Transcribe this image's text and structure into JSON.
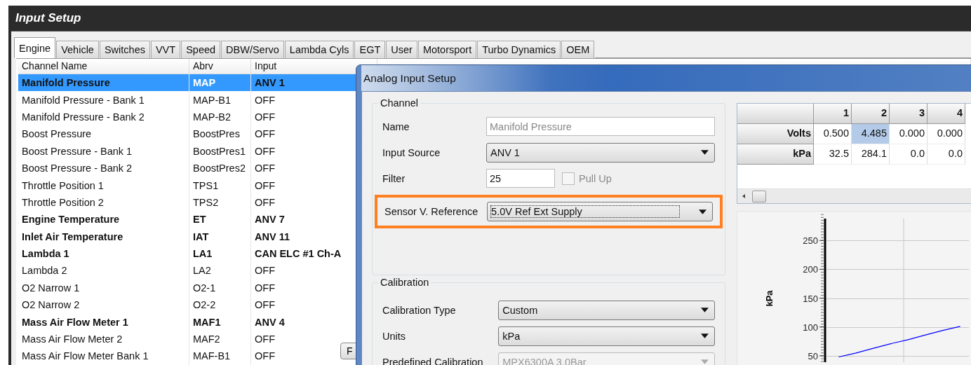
{
  "window": {
    "title": "Input Setup"
  },
  "tabs": [
    {
      "label": "Engine",
      "selected": true
    },
    {
      "label": "Vehicle",
      "selected": false
    },
    {
      "label": "Switches",
      "selected": false
    },
    {
      "label": "VVT",
      "selected": false
    },
    {
      "label": "Speed",
      "selected": false
    },
    {
      "label": "DBW/Servo",
      "selected": false
    },
    {
      "label": "Lambda Cyls",
      "selected": false
    },
    {
      "label": "EGT",
      "selected": false
    },
    {
      "label": "User",
      "selected": false
    },
    {
      "label": "Motorsport",
      "selected": false
    },
    {
      "label": "Turbo Dynamics",
      "selected": false
    },
    {
      "label": "OEM",
      "selected": false
    }
  ],
  "table": {
    "columns": [
      "Channel Name",
      "Abrv",
      "Input"
    ],
    "rows": [
      {
        "name": "Manifold Pressure",
        "abrv": "MAP",
        "input": "ANV 1",
        "assigned": true,
        "selected": true
      },
      {
        "name": "Manifold Pressure - Bank 1",
        "abrv": "MAP-B1",
        "input": "OFF",
        "assigned": false,
        "selected": false
      },
      {
        "name": "Manifold Pressure - Bank 2",
        "abrv": "MAP-B2",
        "input": "OFF",
        "assigned": false,
        "selected": false
      },
      {
        "name": "Boost Pressure",
        "abrv": "BoostPres",
        "input": "OFF",
        "assigned": false,
        "selected": false
      },
      {
        "name": "Boost Pressure - Bank 1",
        "abrv": "BoostPres1",
        "input": "OFF",
        "assigned": false,
        "selected": false
      },
      {
        "name": "Boost Pressure - Bank 2",
        "abrv": "BoostPres2",
        "input": "OFF",
        "assigned": false,
        "selected": false
      },
      {
        "name": "Throttle Position 1",
        "abrv": "TPS1",
        "input": "OFF",
        "assigned": false,
        "selected": false
      },
      {
        "name": "Throttle Position 2",
        "abrv": "TPS2",
        "input": "OFF",
        "assigned": false,
        "selected": false
      },
      {
        "name": "Engine Temperature",
        "abrv": "ET",
        "input": "ANV 7",
        "assigned": true,
        "selected": false
      },
      {
        "name": "Inlet Air Temperature",
        "abrv": "IAT",
        "input": "ANV 11",
        "assigned": true,
        "selected": false
      },
      {
        "name": "Lambda 1",
        "abrv": "LA1",
        "input": "CAN ELC #1 Ch-A",
        "assigned": true,
        "selected": false
      },
      {
        "name": "Lambda 2",
        "abrv": "LA2",
        "input": "OFF",
        "assigned": false,
        "selected": false
      },
      {
        "name": "O2 Narrow 1",
        "abrv": "O2-1",
        "input": "OFF",
        "assigned": false,
        "selected": false
      },
      {
        "name": "O2 Narrow 2",
        "abrv": "O2-2",
        "input": "OFF",
        "assigned": false,
        "selected": false
      },
      {
        "name": "Mass Air Flow Meter 1",
        "abrv": "MAF1",
        "input": "ANV 4",
        "assigned": true,
        "selected": false
      },
      {
        "name": "Mass Air Flow Meter 2",
        "abrv": "MAF2",
        "input": "OFF",
        "assigned": false,
        "selected": false
      },
      {
        "name": "Mass Air Flow Meter Bank 1",
        "abrv": "MAF-B1",
        "input": "OFF",
        "assigned": false,
        "selected": false
      }
    ]
  },
  "hidden_button": {
    "label": "F"
  },
  "dialog": {
    "title": "Analog Input Setup",
    "channel": {
      "legend": "Channel",
      "name_label": "Name",
      "name_value": "Manifold Pressure",
      "source_label": "Input Source",
      "source_value": "ANV 1",
      "filter_label": "Filter",
      "filter_value": "25",
      "pullup_label": "Pull Up",
      "pullup_checked": false,
      "pullup_disabled": true,
      "reference_label": "Sensor V. Reference",
      "reference_value": "5.0V Ref Ext Supply",
      "reference_highlighted": true
    },
    "calibration": {
      "legend": "Calibration",
      "type_label": "Calibration Type",
      "type_value": "Custom",
      "units_label": "Units",
      "units_value": "kPa",
      "predefined_label": "Predefined Calibration",
      "predefined_value": "MPX6300A 3.0Bar",
      "predefined_disabled": true
    },
    "cal_table": {
      "columns": [
        "1",
        "2",
        "3",
        "4"
      ],
      "rows": [
        {
          "label": "Volts",
          "cells": [
            {
              "value": "0.500",
              "selected": false
            },
            {
              "value": "4.485",
              "selected": true
            },
            {
              "value": "0.000",
              "selected": false
            },
            {
              "value": "0.000",
              "selected": false
            }
          ]
        },
        {
          "label": "kPa",
          "cells": [
            {
              "value": "32.5",
              "selected": false
            },
            {
              "value": "284.1",
              "selected": false
            },
            {
              "value": "0.0",
              "selected": false
            },
            {
              "value": "0.0",
              "selected": false
            }
          ]
        }
      ]
    },
    "chart_data": {
      "type": "line",
      "ylabel": "kPa",
      "yticks": [
        50,
        100,
        150,
        200,
        250
      ],
      "ylim": [
        39,
        288
      ],
      "grid": true,
      "categories": [
        null,
        null,
        null,
        null,
        null,
        null,
        null,
        null
      ],
      "series": [
        {
          "color": "#0000ff",
          "values": [
            48,
            55,
            63,
            71,
            78,
            86,
            94,
            101
          ]
        }
      ]
    }
  }
}
